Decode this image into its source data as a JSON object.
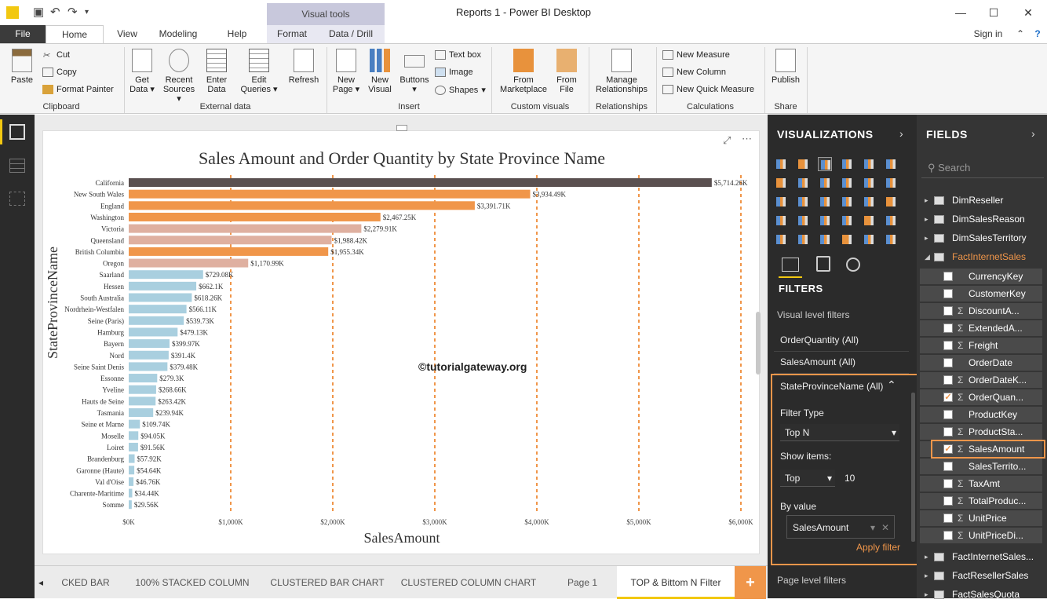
{
  "window": {
    "title": "Reports 1 - Power BI Desktop",
    "signin": "Sign in",
    "ctx_tab": "Visual tools"
  },
  "tabs": [
    "File",
    "Home",
    "View",
    "Modeling",
    "Help",
    "Format",
    "Data / Drill"
  ],
  "ribbon": {
    "clipboard": {
      "paste": "Paste",
      "cut": "Cut",
      "copy": "Copy",
      "format": "Format Painter",
      "group": "Clipboard"
    },
    "external": {
      "get": "Get",
      "get2": "Data",
      "recent": "Recent",
      "recent2": "Sources",
      "enter": "Enter",
      "enter2": "Data",
      "edit": "Edit",
      "edit2": "Queries",
      "refresh": "Refresh",
      "group": "External data"
    },
    "insert": {
      "newpage": "New",
      "newpage2": "Page",
      "newvis": "New",
      "newvis2": "Visual",
      "buttons": "Buttons",
      "textbox": "Text box",
      "image": "Image",
      "shapes": "Shapes",
      "group": "Insert"
    },
    "custom": {
      "market": "From",
      "market2": "Marketplace",
      "file": "From",
      "file2": "File",
      "group": "Custom visuals"
    },
    "rel": {
      "manage": "Manage",
      "manage2": "Relationships",
      "group": "Relationships"
    },
    "calc": {
      "measure": "New Measure",
      "column": "New Column",
      "quick": "New Quick Measure",
      "group": "Calculations"
    },
    "share": {
      "publish": "Publish",
      "group": "Share"
    }
  },
  "chart_data": {
    "type": "bar",
    "title": "Sales Amount and Order Quantity by State Province Name",
    "xlabel": "SalesAmount",
    "ylabel": "StateProvinceName",
    "xticks": [
      "$0K",
      "$1,000K",
      "$2,000K",
      "$3,000K",
      "$4,000K",
      "$5,000K",
      "$6,000K"
    ],
    "xlim": [
      0,
      6000
    ],
    "categories": [
      "California",
      "New South Wales",
      "England",
      "Washington",
      "Victoria",
      "Queensland",
      "British Columbia",
      "Oregon",
      "Saarland",
      "Hessen",
      "South Australia",
      "Nordrhein-Westfalen",
      "Seine (Paris)",
      "Hamburg",
      "Bayern",
      "Nord",
      "Seine Saint Denis",
      "Essonne",
      "Yveline",
      "Hauts de Seine",
      "Tasmania",
      "Seine et Marne",
      "Moselle",
      "Loiret",
      "Brandenburg",
      "Garonne (Haute)",
      "Val d'Oise",
      "Charente-Maritime",
      "Somme"
    ],
    "values": [
      5714.26,
      3934.49,
      3391.71,
      2467.25,
      2279.91,
      1988.42,
      1955.34,
      1170.99,
      729.08,
      662.1,
      618.26,
      566.11,
      539.73,
      479.13,
      399.97,
      391.4,
      379.48,
      279.3,
      268.66,
      263.42,
      239.94,
      109.74,
      94.05,
      91.56,
      57.92,
      54.64,
      46.76,
      34.44,
      29.56
    ],
    "labels": [
      "$5,714.26K",
      "$3,934.49K",
      "$3,391.71K",
      "$2,467.25K",
      "$2,279.91K",
      "$1,988.42K",
      "$1,955.34K",
      "$1,170.99K",
      "$729.08K",
      "$662.1K",
      "$618.26K",
      "$566.11K",
      "$539.73K",
      "$479.13K",
      "$399.97K",
      "$391.4K",
      "$379.48K",
      "$279.3K",
      "$268.66K",
      "$263.42K",
      "$239.94K",
      "$109.74K",
      "$94.05K",
      "$91.56K",
      "$57.92K",
      "$54.64K",
      "$46.76K",
      "$34.44K",
      "$29.56K"
    ],
    "colors": [
      "#5a5050",
      "#f0964a",
      "#f0964a",
      "#f0964a",
      "#dfb0a0",
      "#dfb0a0",
      "#f0964a",
      "#dfb0a0",
      "#a9cfdf",
      "#a9cfdf",
      "#a9cfdf",
      "#a9cfdf",
      "#a9cfdf",
      "#a9cfdf",
      "#a9cfdf",
      "#a9cfdf",
      "#a9cfdf",
      "#a9cfdf",
      "#a9cfdf",
      "#a9cfdf",
      "#a9cfdf",
      "#a9cfdf",
      "#a9cfdf",
      "#a9cfdf",
      "#a9cfdf",
      "#a9cfdf",
      "#a9cfdf",
      "#a9cfdf",
      "#a9cfdf"
    ],
    "grid": "vertical dashed orange"
  },
  "watermark": "©tutorialgateway.org",
  "pages": [
    "CKED BAR",
    "100% STACKED COLUMN",
    "CLUSTERED BAR CHART",
    "CLUSTERED COLUMN CHART",
    "Page 1",
    "TOP & Bittom N Filter"
  ],
  "viz": {
    "header": "VISUALIZATIONS",
    "filters": "FILTERS",
    "visual_level": "Visual level filters",
    "f1": "OrderQuantity (All)",
    "f2": "SalesAmount (All)",
    "f3": "StateProvinceName (All)",
    "filter_type_label": "Filter Type",
    "filter_type": "Top N",
    "show_items": "Show items:",
    "top": "Top",
    "count": "10",
    "by_value": "By value",
    "by_field": "SalesAmount",
    "apply": "Apply filter",
    "page_level": "Page level filters"
  },
  "fields": {
    "header": "FIELDS",
    "search": "Search",
    "tables_top": [
      "DimReseller",
      "DimSalesReason",
      "DimSalesTerritory",
      "FactInternetSales"
    ],
    "items": [
      {
        "name": "CurrencyKey",
        "sigma": "",
        "checked": false
      },
      {
        "name": "CustomerKey",
        "sigma": "",
        "checked": false
      },
      {
        "name": "DiscountA...",
        "sigma": "Σ",
        "checked": false
      },
      {
        "name": "ExtendedA...",
        "sigma": "Σ",
        "checked": false
      },
      {
        "name": "Freight",
        "sigma": "Σ",
        "checked": false
      },
      {
        "name": "OrderDate",
        "sigma": "",
        "checked": false
      },
      {
        "name": "OrderDateK...",
        "sigma": "Σ",
        "checked": false
      },
      {
        "name": "OrderQuan...",
        "sigma": "Σ",
        "checked": true
      },
      {
        "name": "ProductKey",
        "sigma": "",
        "checked": false
      },
      {
        "name": "ProductSta...",
        "sigma": "Σ",
        "checked": false
      },
      {
        "name": "SalesAmount",
        "sigma": "Σ",
        "checked": true
      },
      {
        "name": "SalesTerrito...",
        "sigma": "",
        "checked": false
      },
      {
        "name": "TaxAmt",
        "sigma": "Σ",
        "checked": false
      },
      {
        "name": "TotalProduc...",
        "sigma": "Σ",
        "checked": false
      },
      {
        "name": "UnitPrice",
        "sigma": "Σ",
        "checked": false
      },
      {
        "name": "UnitPriceDi...",
        "sigma": "Σ",
        "checked": false
      }
    ],
    "tables_bottom": [
      "FactInternetSales...",
      "FactResellerSales",
      "FactSalesQuota"
    ]
  }
}
